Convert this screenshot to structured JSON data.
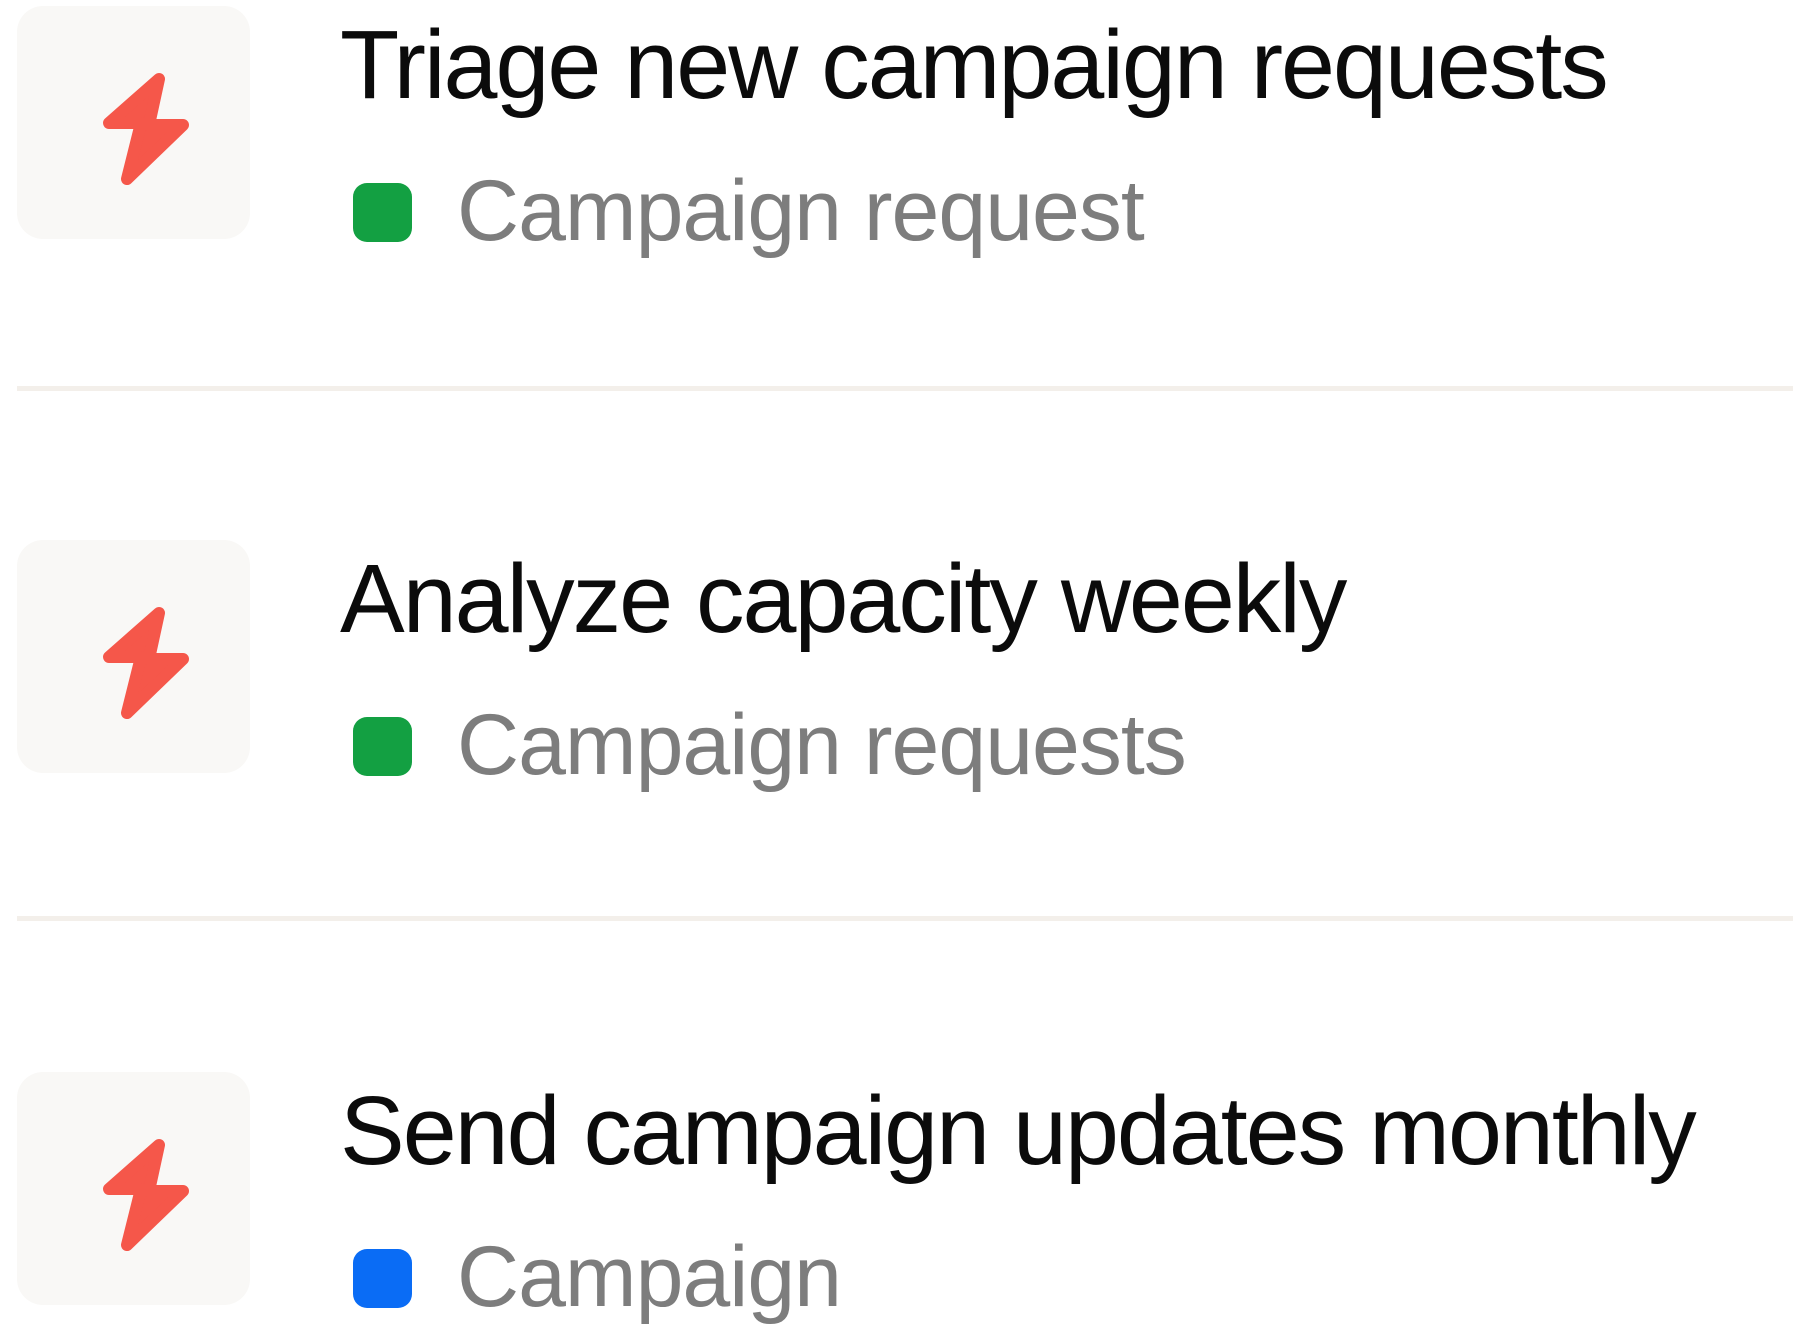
{
  "colors": {
    "icon_accent": "#f5574a",
    "icon_tile_bg": "#f9f8f6",
    "divider": "#f3efea",
    "title_text": "#0b0b0b",
    "tag_text": "#7d7d7d"
  },
  "items": [
    {
      "icon": "lightning-bolt-icon",
      "title": "Triage new campaign requests",
      "tag": {
        "label": "Campaign request",
        "color": "#13a042"
      }
    },
    {
      "icon": "lightning-bolt-icon",
      "title": "Analyze capacity weekly",
      "tag": {
        "label": "Campaign requests",
        "color": "#13a042"
      }
    },
    {
      "icon": "lightning-bolt-icon",
      "title": "Send campaign updates monthly",
      "tag": {
        "label": "Campaign",
        "color": "#0a6cf5"
      }
    }
  ]
}
